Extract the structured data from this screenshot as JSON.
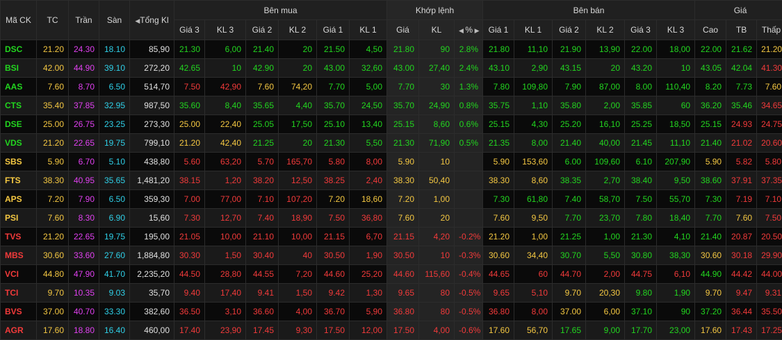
{
  "header": {
    "symbol": "Mã CK",
    "ref": "TC",
    "ceiling": "Trần",
    "floor": "Sàn",
    "total_vol": "Tổng Kl",
    "buy_group": "Bên mua",
    "match_group": "Khớp lệnh",
    "sell_group": "Bên bán",
    "price_group": "Giá",
    "bid3_price": "Giá 3",
    "bid3_vol": "KL 3",
    "bid2_price": "Giá 2",
    "bid2_vol": "KL 2",
    "bid1_price": "Giá 1",
    "bid1_vol": "KL 1",
    "match_price": "Giá",
    "match_vol": "KL",
    "match_pct": "%",
    "ask1_price": "Giá 1",
    "ask1_vol": "KL 1",
    "ask2_price": "Giá 2",
    "ask2_vol": "KL 2",
    "ask3_price": "Giá 3",
    "ask3_vol": "KL 3",
    "high": "Cao",
    "avg": "TB",
    "low": "Thấp"
  },
  "colors": {
    "up": "#22d61f",
    "down": "#f23a3a",
    "ref": "#f5c842",
    "ceiling": "#e040f0",
    "floor": "#2fd0e8",
    "neutral": "#e0e0e0"
  },
  "rows": [
    {
      "sym": [
        "DSC",
        "up"
      ],
      "tc": "21.20",
      "tran": "24.30",
      "san": "18.10",
      "vol": "85,90",
      "c": [
        [
          "21.30",
          "up"
        ],
        [
          "6,00",
          "up"
        ],
        [
          "21.40",
          "up"
        ],
        [
          "20",
          "up"
        ],
        [
          "21.50",
          "up"
        ],
        [
          "4,50",
          "up"
        ],
        [
          "21.80",
          "up"
        ],
        [
          "90",
          "up"
        ],
        [
          "2.8%",
          "up"
        ],
        [
          "21.80",
          "up"
        ],
        [
          "11,10",
          "up"
        ],
        [
          "21.90",
          "up"
        ],
        [
          "13,90",
          "up"
        ],
        [
          "22.00",
          "up"
        ],
        [
          "18,00",
          "up"
        ],
        [
          "22.00",
          "up"
        ],
        [
          "21.62",
          "up"
        ],
        [
          "21.20",
          "ref"
        ]
      ]
    },
    {
      "sym": [
        "BSI",
        "up"
      ],
      "tc": "42.00",
      "tran": "44.90",
      "san": "39.10",
      "vol": "272,20",
      "c": [
        [
          "42.65",
          "up"
        ],
        [
          "10",
          "up"
        ],
        [
          "42.90",
          "up"
        ],
        [
          "20",
          "up"
        ],
        [
          "43.00",
          "up"
        ],
        [
          "32,60",
          "up"
        ],
        [
          "43.00",
          "up"
        ],
        [
          "27,40",
          "up"
        ],
        [
          "2.4%",
          "up"
        ],
        [
          "43.10",
          "up"
        ],
        [
          "2,90",
          "up"
        ],
        [
          "43.15",
          "up"
        ],
        [
          "20",
          "up"
        ],
        [
          "43.20",
          "up"
        ],
        [
          "10",
          "up"
        ],
        [
          "43.05",
          "up"
        ],
        [
          "42.04",
          "up"
        ],
        [
          "41.30",
          "dn"
        ]
      ]
    },
    {
      "sym": [
        "AAS",
        "up"
      ],
      "tc": "7.60",
      "tran": "8.70",
      "san": "6.50",
      "vol": "514,70",
      "c": [
        [
          "7.50",
          "dn"
        ],
        [
          "42,90",
          "dn"
        ],
        [
          "7.60",
          "ref"
        ],
        [
          "74,20",
          "ref"
        ],
        [
          "7.70",
          "up"
        ],
        [
          "5,00",
          "up"
        ],
        [
          "7.70",
          "up"
        ],
        [
          "30",
          "up"
        ],
        [
          "1.3%",
          "up"
        ],
        [
          "7.80",
          "up"
        ],
        [
          "109,80",
          "up"
        ],
        [
          "7.90",
          "up"
        ],
        [
          "87,00",
          "up"
        ],
        [
          "8.00",
          "up"
        ],
        [
          "110,40",
          "up"
        ],
        [
          "8.20",
          "up"
        ],
        [
          "7.73",
          "up"
        ],
        [
          "7.60",
          "ref"
        ]
      ]
    },
    {
      "sym": [
        "CTS",
        "up"
      ],
      "tc": "35.40",
      "tran": "37.85",
      "san": "32.95",
      "vol": "987,50",
      "c": [
        [
          "35.60",
          "up"
        ],
        [
          "8,40",
          "up"
        ],
        [
          "35.65",
          "up"
        ],
        [
          "4,40",
          "up"
        ],
        [
          "35.70",
          "up"
        ],
        [
          "24,50",
          "up"
        ],
        [
          "35.70",
          "up"
        ],
        [
          "24,90",
          "up"
        ],
        [
          "0.8%",
          "up"
        ],
        [
          "35.75",
          "up"
        ],
        [
          "1,10",
          "up"
        ],
        [
          "35.80",
          "up"
        ],
        [
          "2,00",
          "up"
        ],
        [
          "35.85",
          "up"
        ],
        [
          "60",
          "up"
        ],
        [
          "36.20",
          "up"
        ],
        [
          "35.46",
          "up"
        ],
        [
          "34.65",
          "dn"
        ]
      ]
    },
    {
      "sym": [
        "DSE",
        "up"
      ],
      "tc": "25.00",
      "tran": "26.75",
      "san": "23.25",
      "vol": "273,30",
      "c": [
        [
          "25.00",
          "ref"
        ],
        [
          "22,40",
          "ref"
        ],
        [
          "25.05",
          "up"
        ],
        [
          "17,50",
          "up"
        ],
        [
          "25.10",
          "up"
        ],
        [
          "13,40",
          "up"
        ],
        [
          "25.15",
          "up"
        ],
        [
          "8,60",
          "up"
        ],
        [
          "0.6%",
          "up"
        ],
        [
          "25.15",
          "up"
        ],
        [
          "4,30",
          "up"
        ],
        [
          "25.20",
          "up"
        ],
        [
          "16,10",
          "up"
        ],
        [
          "25.25",
          "up"
        ],
        [
          "18,50",
          "up"
        ],
        [
          "25.15",
          "up"
        ],
        [
          "24.93",
          "dn"
        ],
        [
          "24.75",
          "dn"
        ]
      ]
    },
    {
      "sym": [
        "VDS",
        "up"
      ],
      "tc": "21.20",
      "tran": "22.65",
      "san": "19.75",
      "vol": "799,10",
      "c": [
        [
          "21.20",
          "ref"
        ],
        [
          "42,40",
          "ref"
        ],
        [
          "21.25",
          "up"
        ],
        [
          "20",
          "up"
        ],
        [
          "21.30",
          "up"
        ],
        [
          "5,50",
          "up"
        ],
        [
          "21.30",
          "up"
        ],
        [
          "71,90",
          "up"
        ],
        [
          "0.5%",
          "up"
        ],
        [
          "21.35",
          "up"
        ],
        [
          "8,00",
          "up"
        ],
        [
          "21.40",
          "up"
        ],
        [
          "40,00",
          "up"
        ],
        [
          "21.45",
          "up"
        ],
        [
          "11,10",
          "up"
        ],
        [
          "21.40",
          "up"
        ],
        [
          "21.02",
          "dn"
        ],
        [
          "20.60",
          "dn"
        ]
      ]
    },
    {
      "sym": [
        "SBS",
        "ref"
      ],
      "tc": "5.90",
      "tran": "6.70",
      "san": "5.10",
      "vol": "438,80",
      "c": [
        [
          "5.60",
          "dn"
        ],
        [
          "63,20",
          "dn"
        ],
        [
          "5.70",
          "dn"
        ],
        [
          "165,70",
          "dn"
        ],
        [
          "5.80",
          "dn"
        ],
        [
          "8,00",
          "dn"
        ],
        [
          "5.90",
          "ref"
        ],
        [
          "10",
          "ref"
        ],
        [
          "",
          ""
        ],
        [
          "5.90",
          "ref"
        ],
        [
          "153,60",
          "ref"
        ],
        [
          "6.00",
          "up"
        ],
        [
          "109,60",
          "up"
        ],
        [
          "6.10",
          "up"
        ],
        [
          "207,90",
          "up"
        ],
        [
          "5.90",
          "ref"
        ],
        [
          "5.82",
          "dn"
        ],
        [
          "5.80",
          "dn"
        ]
      ]
    },
    {
      "sym": [
        "FTS",
        "ref"
      ],
      "tc": "38.30",
      "tran": "40.95",
      "san": "35.65",
      "vol": "1,481,20",
      "c": [
        [
          "38.15",
          "dn"
        ],
        [
          "1,20",
          "dn"
        ],
        [
          "38.20",
          "dn"
        ],
        [
          "12,50",
          "dn"
        ],
        [
          "38.25",
          "dn"
        ],
        [
          "2,40",
          "dn"
        ],
        [
          "38.30",
          "ref"
        ],
        [
          "50,40",
          "ref"
        ],
        [
          "",
          ""
        ],
        [
          "38.30",
          "ref"
        ],
        [
          "8,60",
          "ref"
        ],
        [
          "38.35",
          "up"
        ],
        [
          "2,70",
          "up"
        ],
        [
          "38.40",
          "up"
        ],
        [
          "9,50",
          "up"
        ],
        [
          "38.60",
          "up"
        ],
        [
          "37.91",
          "dn"
        ],
        [
          "37.35",
          "dn"
        ]
      ]
    },
    {
      "sym": [
        "APS",
        "ref"
      ],
      "tc": "7.20",
      "tran": "7.90",
      "san": "6.50",
      "vol": "359,30",
      "c": [
        [
          "7.00",
          "dn"
        ],
        [
          "77,00",
          "dn"
        ],
        [
          "7.10",
          "dn"
        ],
        [
          "107,20",
          "dn"
        ],
        [
          "7.20",
          "ref"
        ],
        [
          "18,60",
          "ref"
        ],
        [
          "7.20",
          "ref"
        ],
        [
          "1,00",
          "ref"
        ],
        [
          "",
          ""
        ],
        [
          "7.30",
          "up"
        ],
        [
          "61,80",
          "up"
        ],
        [
          "7.40",
          "up"
        ],
        [
          "58,70",
          "up"
        ],
        [
          "7.50",
          "up"
        ],
        [
          "55,70",
          "up"
        ],
        [
          "7.30",
          "up"
        ],
        [
          "7.19",
          "dn"
        ],
        [
          "7.10",
          "dn"
        ]
      ]
    },
    {
      "sym": [
        "PSI",
        "ref"
      ],
      "tc": "7.60",
      "tran": "8.30",
      "san": "6.90",
      "vol": "15,60",
      "c": [
        [
          "7.30",
          "dn"
        ],
        [
          "12,70",
          "dn"
        ],
        [
          "7.40",
          "dn"
        ],
        [
          "18,90",
          "dn"
        ],
        [
          "7.50",
          "dn"
        ],
        [
          "36,80",
          "dn"
        ],
        [
          "7.60",
          "ref"
        ],
        [
          "20",
          "ref"
        ],
        [
          "",
          ""
        ],
        [
          "7.60",
          "ref"
        ],
        [
          "9,50",
          "ref"
        ],
        [
          "7.70",
          "up"
        ],
        [
          "23,70",
          "up"
        ],
        [
          "7.80",
          "up"
        ],
        [
          "18,40",
          "up"
        ],
        [
          "7.70",
          "up"
        ],
        [
          "7.60",
          "ref"
        ],
        [
          "7.50",
          "dn"
        ]
      ]
    },
    {
      "sym": [
        "TVS",
        "dn"
      ],
      "tc": "21.20",
      "tran": "22.65",
      "san": "19.75",
      "vol": "195,00",
      "c": [
        [
          "21.05",
          "dn"
        ],
        [
          "10,00",
          "dn"
        ],
        [
          "21.10",
          "dn"
        ],
        [
          "10,00",
          "dn"
        ],
        [
          "21.15",
          "dn"
        ],
        [
          "6,70",
          "dn"
        ],
        [
          "21.15",
          "dn"
        ],
        [
          "4,20",
          "dn"
        ],
        [
          "-0.2%",
          "dn"
        ],
        [
          "21.20",
          "ref"
        ],
        [
          "1,00",
          "ref"
        ],
        [
          "21.25",
          "up"
        ],
        [
          "1,00",
          "up"
        ],
        [
          "21.30",
          "up"
        ],
        [
          "4,10",
          "up"
        ],
        [
          "21.40",
          "up"
        ],
        [
          "20.87",
          "dn"
        ],
        [
          "20.50",
          "dn"
        ]
      ]
    },
    {
      "sym": [
        "MBS",
        "dn"
      ],
      "tc": "30.60",
      "tran": "33.60",
      "san": "27.60",
      "vol": "1,884,80",
      "c": [
        [
          "30.30",
          "dn"
        ],
        [
          "1,50",
          "dn"
        ],
        [
          "30.40",
          "dn"
        ],
        [
          "40",
          "dn"
        ],
        [
          "30.50",
          "dn"
        ],
        [
          "1,90",
          "dn"
        ],
        [
          "30.50",
          "dn"
        ],
        [
          "10",
          "dn"
        ],
        [
          "-0.3%",
          "dn"
        ],
        [
          "30.60",
          "ref"
        ],
        [
          "34,40",
          "ref"
        ],
        [
          "30.70",
          "up"
        ],
        [
          "5,50",
          "up"
        ],
        [
          "30.80",
          "up"
        ],
        [
          "38,30",
          "up"
        ],
        [
          "30.60",
          "ref"
        ],
        [
          "30.18",
          "dn"
        ],
        [
          "29.90",
          "dn"
        ]
      ]
    },
    {
      "sym": [
        "VCI",
        "dn"
      ],
      "tc": "44.80",
      "tran": "47.90",
      "san": "41.70",
      "vol": "2,235,20",
      "c": [
        [
          "44.50",
          "dn"
        ],
        [
          "28,80",
          "dn"
        ],
        [
          "44.55",
          "dn"
        ],
        [
          "7,20",
          "dn"
        ],
        [
          "44.60",
          "dn"
        ],
        [
          "25,20",
          "dn"
        ],
        [
          "44.60",
          "dn"
        ],
        [
          "115,60",
          "dn"
        ],
        [
          "-0.4%",
          "dn"
        ],
        [
          "44.65",
          "dn"
        ],
        [
          "60",
          "dn"
        ],
        [
          "44.70",
          "dn"
        ],
        [
          "2,00",
          "dn"
        ],
        [
          "44.75",
          "dn"
        ],
        [
          "6,10",
          "dn"
        ],
        [
          "44.90",
          "up"
        ],
        [
          "44.42",
          "dn"
        ],
        [
          "44.00",
          "dn"
        ]
      ]
    },
    {
      "sym": [
        "TCI",
        "dn"
      ],
      "tc": "9.70",
      "tran": "10.35",
      "san": "9.03",
      "vol": "35,70",
      "c": [
        [
          "9.40",
          "dn"
        ],
        [
          "17,40",
          "dn"
        ],
        [
          "9.41",
          "dn"
        ],
        [
          "1,50",
          "dn"
        ],
        [
          "9.42",
          "dn"
        ],
        [
          "1,30",
          "dn"
        ],
        [
          "9.65",
          "dn"
        ],
        [
          "80",
          "dn"
        ],
        [
          "-0.5%",
          "dn"
        ],
        [
          "9.65",
          "dn"
        ],
        [
          "5,10",
          "dn"
        ],
        [
          "9.70",
          "ref"
        ],
        [
          "20,30",
          "ref"
        ],
        [
          "9.80",
          "up"
        ],
        [
          "1,90",
          "up"
        ],
        [
          "9.70",
          "ref"
        ],
        [
          "9.47",
          "dn"
        ],
        [
          "9.31",
          "dn"
        ]
      ]
    },
    {
      "sym": [
        "BVS",
        "dn"
      ],
      "tc": "37.00",
      "tran": "40.70",
      "san": "33.30",
      "vol": "382,60",
      "c": [
        [
          "36.50",
          "dn"
        ],
        [
          "3,10",
          "dn"
        ],
        [
          "36.60",
          "dn"
        ],
        [
          "4,00",
          "dn"
        ],
        [
          "36.70",
          "dn"
        ],
        [
          "5,90",
          "dn"
        ],
        [
          "36.80",
          "dn"
        ],
        [
          "80",
          "dn"
        ],
        [
          "-0.5%",
          "dn"
        ],
        [
          "36.80",
          "dn"
        ],
        [
          "8,00",
          "dn"
        ],
        [
          "37.00",
          "ref"
        ],
        [
          "6,00",
          "ref"
        ],
        [
          "37.10",
          "up"
        ],
        [
          "90",
          "up"
        ],
        [
          "37.20",
          "up"
        ],
        [
          "36.44",
          "dn"
        ],
        [
          "35.50",
          "dn"
        ]
      ]
    },
    {
      "sym": [
        "AGR",
        "dn"
      ],
      "tc": "17.60",
      "tran": "18.80",
      "san": "16.40",
      "vol": "460,00",
      "c": [
        [
          "17.40",
          "dn"
        ],
        [
          "23,90",
          "dn"
        ],
        [
          "17.45",
          "dn"
        ],
        [
          "9,30",
          "dn"
        ],
        [
          "17.50",
          "dn"
        ],
        [
          "12,00",
          "dn"
        ],
        [
          "17.50",
          "dn"
        ],
        [
          "4,00",
          "dn"
        ],
        [
          "-0.6%",
          "dn"
        ],
        [
          "17.60",
          "ref"
        ],
        [
          "56,70",
          "ref"
        ],
        [
          "17.65",
          "up"
        ],
        [
          "9,00",
          "up"
        ],
        [
          "17.70",
          "up"
        ],
        [
          "23,00",
          "up"
        ],
        [
          "17.60",
          "ref"
        ],
        [
          "17.43",
          "dn"
        ],
        [
          "17.25",
          "dn"
        ]
      ]
    }
  ]
}
